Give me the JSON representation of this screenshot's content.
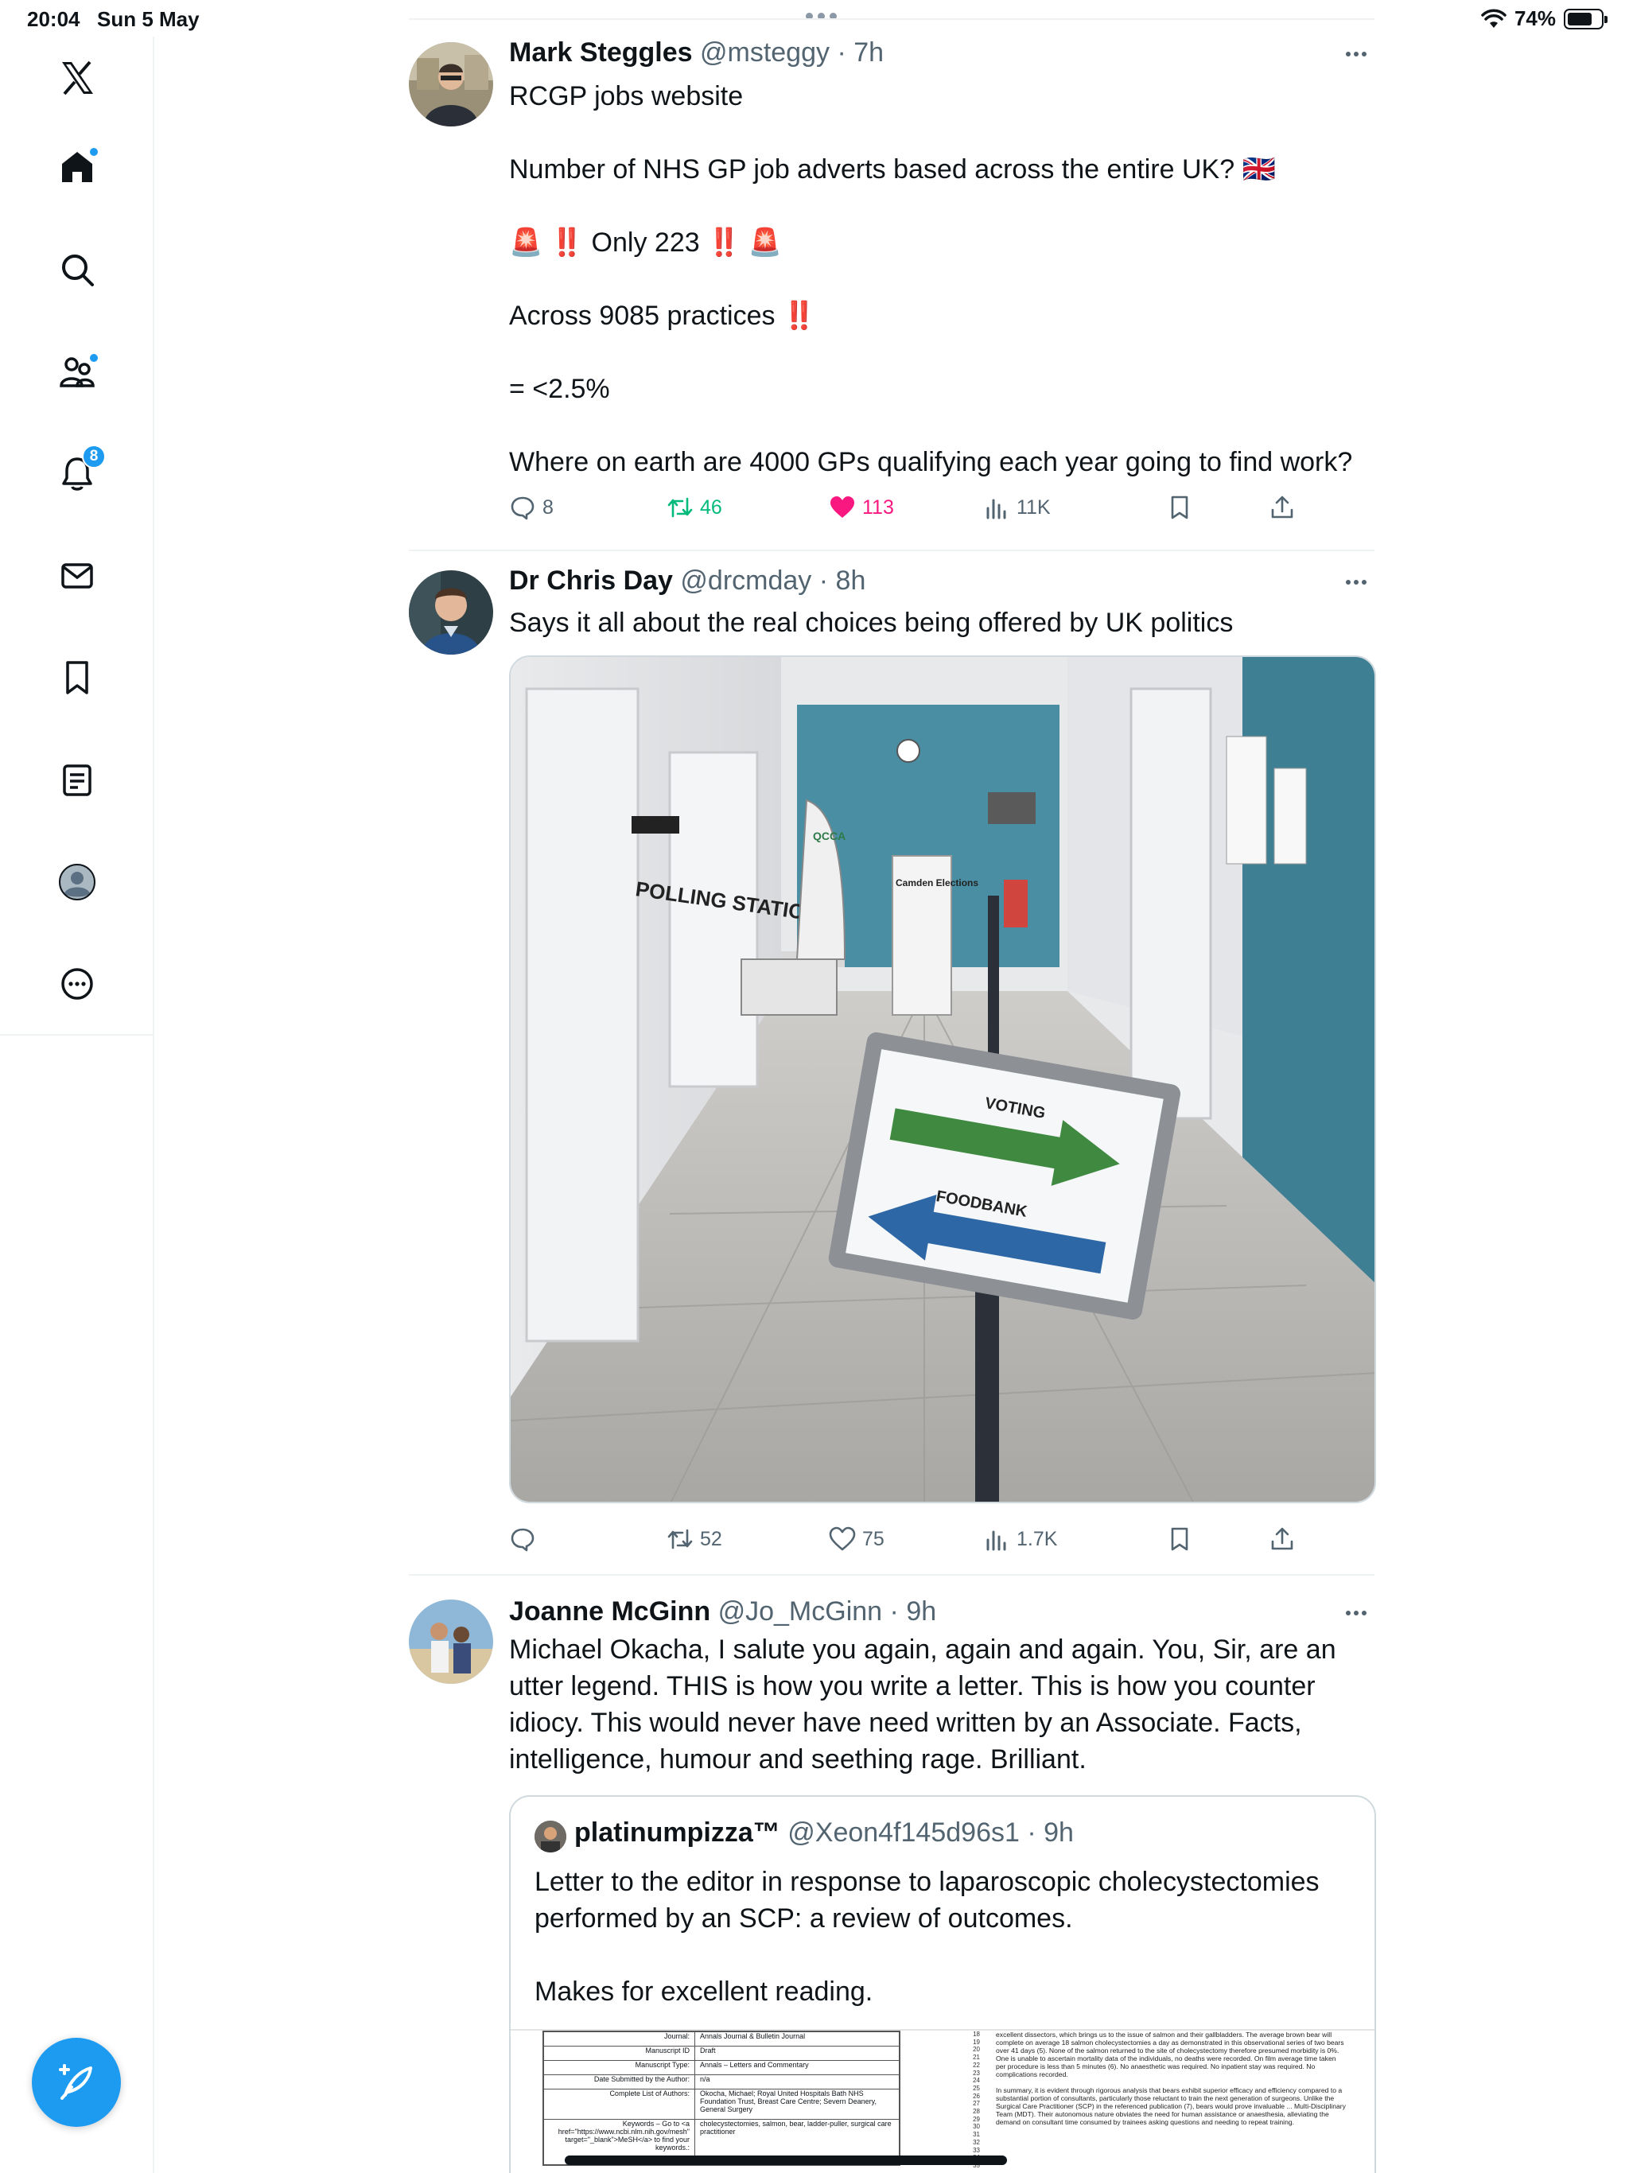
{
  "status": {
    "time": "20:04",
    "date": "Sun 5 May",
    "battery": "74%"
  },
  "sidebar": {
    "items": [
      {
        "name": "logo-x"
      },
      {
        "name": "home"
      },
      {
        "name": "search"
      },
      {
        "name": "communities"
      },
      {
        "name": "notifications",
        "badge": "8"
      },
      {
        "name": "messages"
      },
      {
        "name": "bookmarks"
      },
      {
        "name": "lists"
      },
      {
        "name": "profile"
      },
      {
        "name": "more"
      }
    ],
    "notification_badge": "8"
  },
  "colors": {
    "accent": "#1d9bf0",
    "retweet": "#00ba7c",
    "like": "#f91880",
    "muted": "#536471"
  },
  "tweets": [
    {
      "name": "Mark Steggles",
      "handle": "@msteggy",
      "dot": "·",
      "time": "7h",
      "lines": [
        "RCGP jobs website",
        "",
        "Number of NHS GP job adverts based across the entire UK? 🇬🇧",
        "",
        "🚨 ‼️ Only 223 ‼️ 🚨",
        "",
        "Across 9085 practices ‼️",
        "",
        "= <2.5%",
        "",
        "Where on earth are 4000 GPs qualifying each year going to find work?"
      ],
      "replies": "8",
      "retweets": "46",
      "likes": "113",
      "views": "11K"
    },
    {
      "name": "Dr Chris Day",
      "handle": "@drcmday",
      "dot": "·",
      "time": "8h",
      "lines": [
        "Says it all about the real choices being offered by UK politics"
      ],
      "image": {
        "sign_voting": "VOTING",
        "sign_foodbank": "FOODBANK",
        "polling_station": "POLLING STATION",
        "camden": "Camden Elections",
        "qcca": "QCCA"
      },
      "replies": "",
      "retweets": "52",
      "likes": "75",
      "views": "1.7K"
    },
    {
      "name": "Joanne McGinn",
      "handle": "@Jo_McGinn",
      "dot": "·",
      "time": "9h",
      "text": "Michael Okacha, I salute you again, again and again. You, Sir, are an utter legend. THIS is how you write a letter. This is how you counter idiocy. This would never have need written by an Associate. Facts, intelligence, humour and seething rage. Brilliant.",
      "quote": {
        "name": "platinumpizza™",
        "handle": "@Xeon4f145d96s1",
        "dot": "·",
        "time": "9h",
        "lines": [
          "Letter to the editor in response to laparoscopic cholecystectomies performed by an SCP: a review of outcomes.",
          "",
          "Makes for excellent reading."
        ],
        "doc": {
          "rows": [
            {
              "label": "Journal:",
              "value": "Annals Journal & Bulletin Journal"
            },
            {
              "label": "Manuscript ID",
              "value": "Draft"
            },
            {
              "label": "Manuscript Type:",
              "value": "Annals – Letters and Commentary"
            },
            {
              "label": "Date Submitted by the Author:",
              "value": "n/a"
            },
            {
              "label": "Complete List of Authors:",
              "value": "Okocha, Michael; Royal United Hospitals Bath NHS Foundation Trust, Breast Care Centre; Severn Deanery, General Surgery"
            },
            {
              "label": "Keywords – Go to <a href=\"https://www.ncbi.nlm.nih.gov/mesh\" target=\"_blank\">MeSH</a> to find your keywords.:",
              "value": "cholecystectomies, salmon, bear, ladder-puller, surgical care practitioner"
            }
          ],
          "line_numbers": [
            "18",
            "19",
            "20",
            "21",
            "22",
            "23",
            "24",
            "25",
            "26",
            "27",
            "28",
            "29",
            "30",
            "31",
            "32",
            "33",
            "34",
            "35"
          ],
          "right_text_1": "excellent dissectors, which brings us to the issue of salmon and their gallbladders. The average brown bear will complete on average 18 salmon cholecystectomies a day as demonstrated in this observational series of two bears over 41 days (5). None of the salmon returned to the site of cholecystectomy therefore presumed morbidity is 0%. One is unable to ascertain mortality data of the individuals, no deaths were recorded. On film average time taken per procedure is less than 5 minutes (6). No anaesthetic was required. No inpatient stay was required. No complications recorded.",
          "right_text_2": "In summary, it is evident through rigorous analysis that bears exhibit superior efficacy and efficiency compared to a substantial portion of consultants, particularly those reluctant to train the next generation of surgeons. Unlike the Surgical Care Practitioner (SCP) in the referenced publication (7), bears would prove invaluable ... Multi-Disciplinary Team (MDT). Their autonomous nature obviates the need for human assistance or anaesthesia, alleviating the demand on consultant time consumed by trainees asking questions and needing to repeat training."
        }
      }
    }
  ]
}
